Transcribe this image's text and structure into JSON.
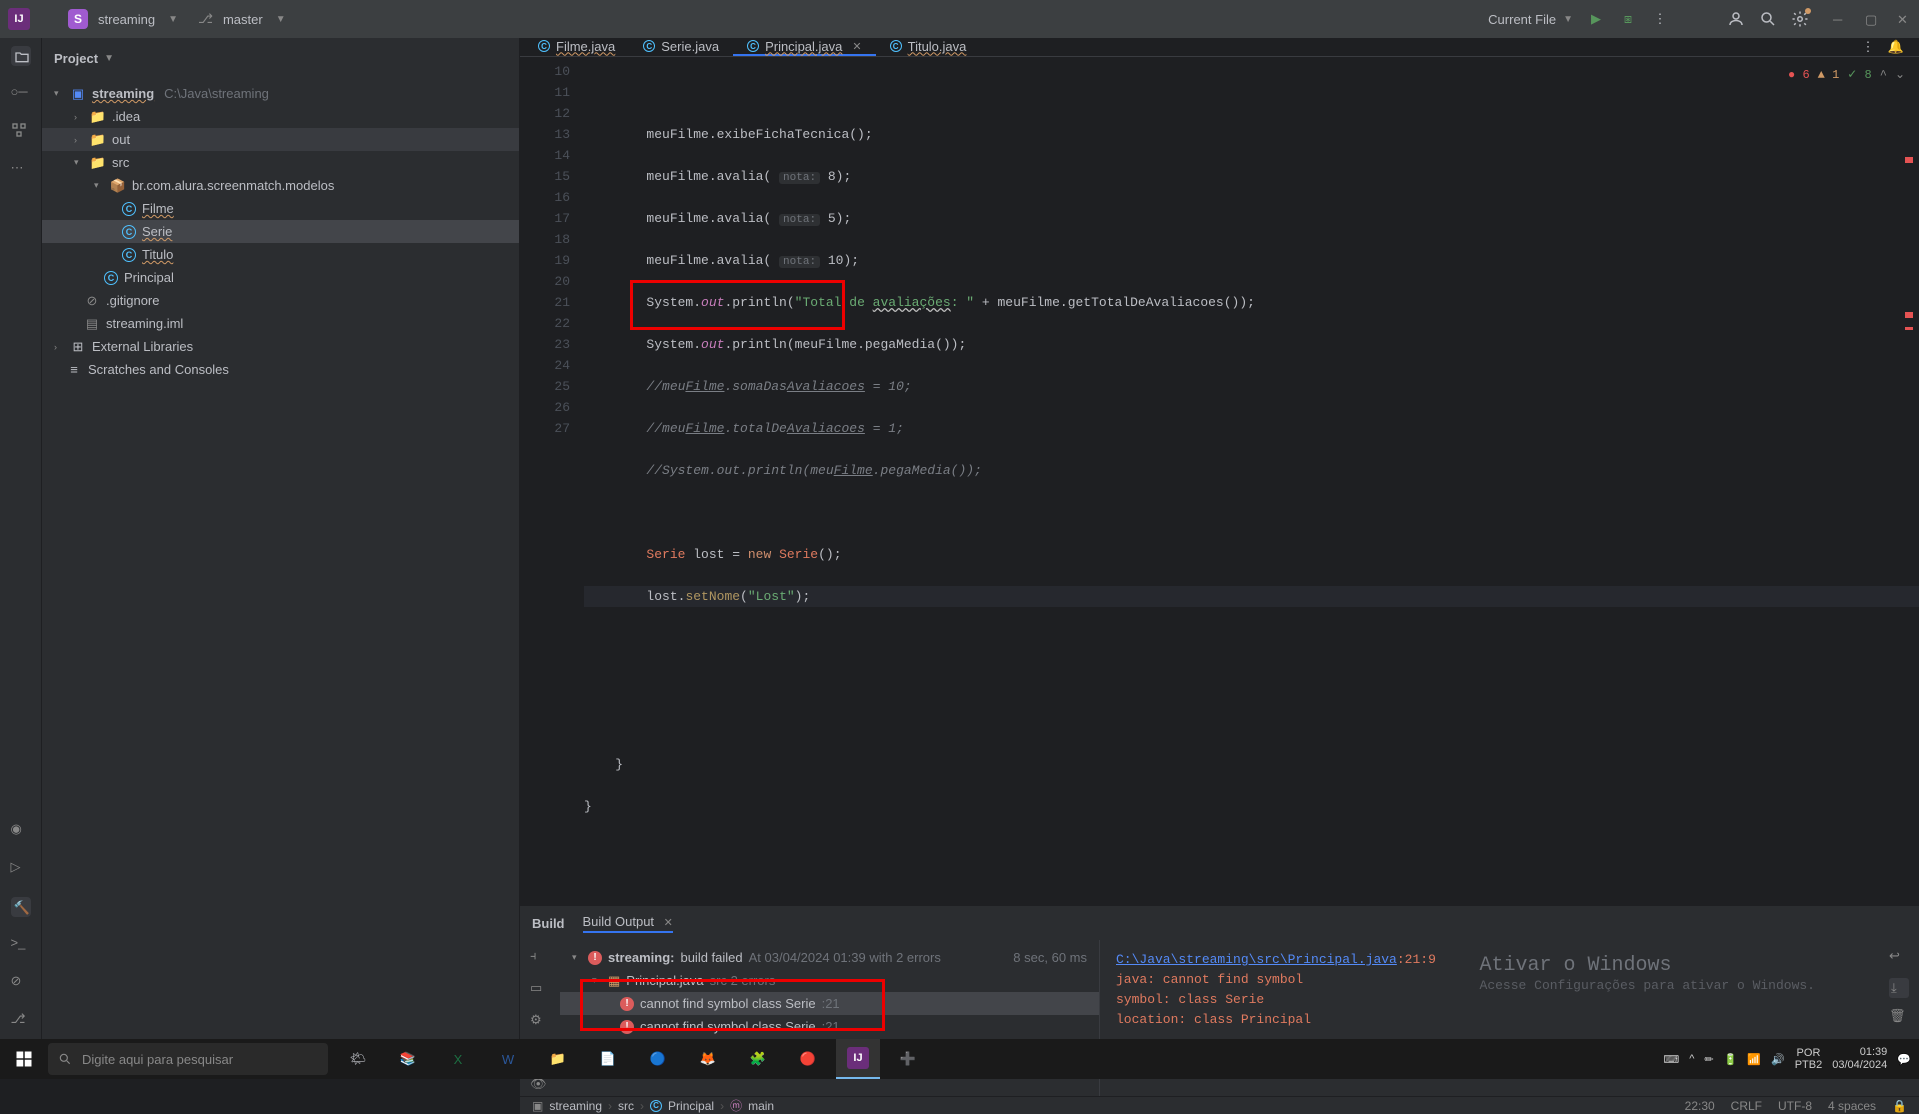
{
  "titlebar": {
    "project_letter": "S",
    "project_name": "streaming",
    "branch": "master",
    "run_config": "Current File"
  },
  "project_panel": {
    "title": "Project",
    "root_name": "streaming",
    "root_path": "C:\\Java\\streaming",
    "folders": {
      "idea": ".idea",
      "out": "out",
      "src": "src",
      "pkg": "br.com.alura.screenmatch.modelos"
    },
    "classes": {
      "filme": "Filme",
      "serie": "Serie",
      "titulo": "Titulo",
      "principal": "Principal"
    },
    "files": {
      "gitignore": ".gitignore",
      "iml": "streaming.iml"
    },
    "external": "External Libraries",
    "scratches": "Scratches and Consoles"
  },
  "tabs": {
    "filme": "Filme.java",
    "serie": "Serie.java",
    "principal": "Principal.java",
    "titulo": "Titulo.java"
  },
  "inspections": {
    "errors": "6",
    "warnings": "1",
    "weak": "8"
  },
  "code": {
    "line_start": 10,
    "line_end": 27,
    "l11": "meuFilme.exibeFichaTecnica();",
    "l12_a": "meuFilme.avalia(",
    "l12_hint": "nota:",
    "l12_b": " 8);",
    "l13_b": " 5);",
    "l14_b": " 10);",
    "l15_a": "System.",
    "l15_out": "out",
    "l15_p": ".println(",
    "l15_s": "\"Total de avaliações: \"",
    "l15_r": " + meuFilme.getTotalDeAvaliacoes());",
    "l16_r": "(meuFilme.pegaMedia());",
    "l17": "//meuFilme.somaDasAvaliacoes = 10;",
    "l18": "//meuFilme.totalDeAvaliacoes = 1;",
    "l19": "//System.out.println(meuFilme.pegaMedia());",
    "l21_a": "Serie",
    "l21_b": " lost = ",
    "l21_new": "new ",
    "l21_c": "Serie",
    "l21_d": "();",
    "l22_a": "lost.",
    "l22_m": "setNome",
    "l22_b": "(",
    "l22_s": "\"Lost\"",
    "l22_c": ");"
  },
  "build": {
    "tab_build": "Build",
    "tab_output": "Build Output",
    "header_a": "streaming:",
    "header_b": "build failed",
    "header_c": "At 03/04/2024 01:39 with 2 errors",
    "time": "8 sec, 60 ms",
    "file": "Principal.java",
    "file_hint": "src 2 errors",
    "err1": "cannot find symbol class Serie",
    "err1_line": ":21",
    "err2": "cannot find symbol class Serie",
    "err2_line": ":21",
    "path": "C:\\Java\\streaming\\src\\Principal.java",
    "loc": ":21:9",
    "msg1": "java: cannot find symbol",
    "msg2": "  symbol:   class Serie",
    "msg3": "  location: class Principal"
  },
  "watermark": {
    "t1": "Ativar o Windows",
    "t2": "Acesse Configurações para ativar o Windows."
  },
  "breadcrumbs": {
    "a": "streaming",
    "b": "src",
    "c": "Principal",
    "d": "main"
  },
  "statusbar": {
    "pos": "22:30",
    "eol": "CRLF",
    "enc": "UTF-8",
    "indent": "4 spaces"
  },
  "taskbar": {
    "search_placeholder": "Digite aqui para pesquisar",
    "lang1": "POR",
    "lang2": "PTB2",
    "time": "01:39",
    "date": "03/04/2024"
  }
}
